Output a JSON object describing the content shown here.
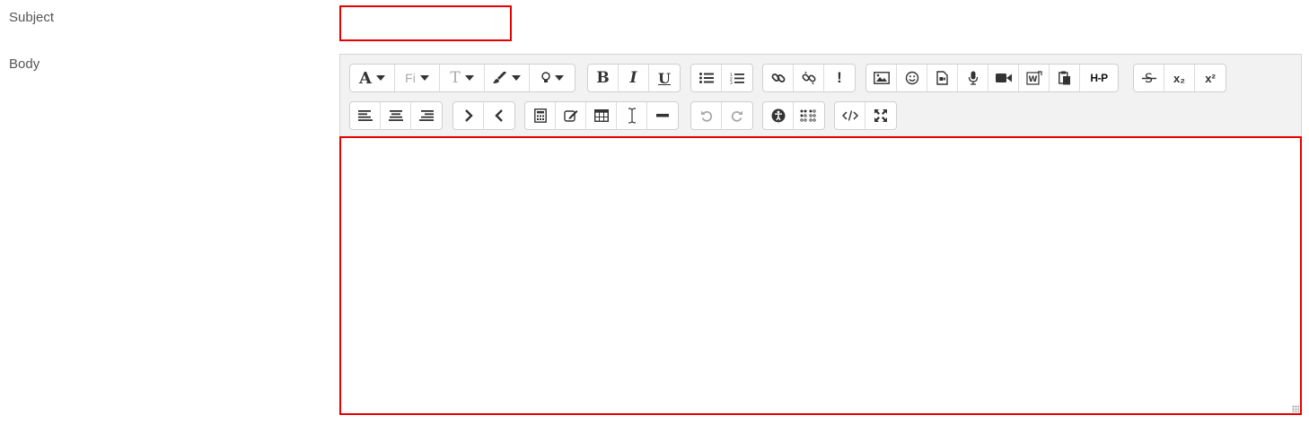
{
  "form": {
    "subject_label": "Subject",
    "body_label": "Body",
    "subject_value": "",
    "body_value": ""
  },
  "toolbar": {
    "font_family_label": "A",
    "font_size_label": "Fi",
    "text_size_label": "T",
    "bold_label": "B",
    "italic_label": "I",
    "underline_label": "U",
    "subscript_label": "x₂",
    "superscript_label": "x²",
    "h5p_label": "H-P",
    "special_char_label": "!",
    "icons_row1": [
      "font-family-icon",
      "font-size-icon",
      "text-size-icon",
      "paint-brush-icon",
      "lightbulb-icon",
      "bold-icon",
      "italic-icon",
      "underline-icon",
      "unordered-list-icon",
      "ordered-list-icon",
      "link-icon",
      "unlink-icon",
      "special-character-icon",
      "image-icon",
      "emoticon-icon",
      "media-file-icon",
      "microphone-icon",
      "video-camera-icon",
      "word-import-icon",
      "paste-icon",
      "h5p-icon",
      "strikethrough-icon",
      "subscript-icon",
      "superscript-icon"
    ],
    "icons_row2": [
      "align-left-icon",
      "align-center-icon",
      "align-right-icon",
      "indent-icon",
      "outdent-icon",
      "calculator-icon",
      "edit-equation-icon",
      "table-icon",
      "cursor-icon",
      "horizontal-rule-icon",
      "undo-icon",
      "redo-icon",
      "accessibility-icon",
      "braille-icon",
      "html-code-icon",
      "fullscreen-icon"
    ]
  },
  "colors": {
    "highlight_border": "#e60000",
    "toolbar_bg": "#f2f2f2",
    "disabled_icon": "#a8a8a8"
  }
}
